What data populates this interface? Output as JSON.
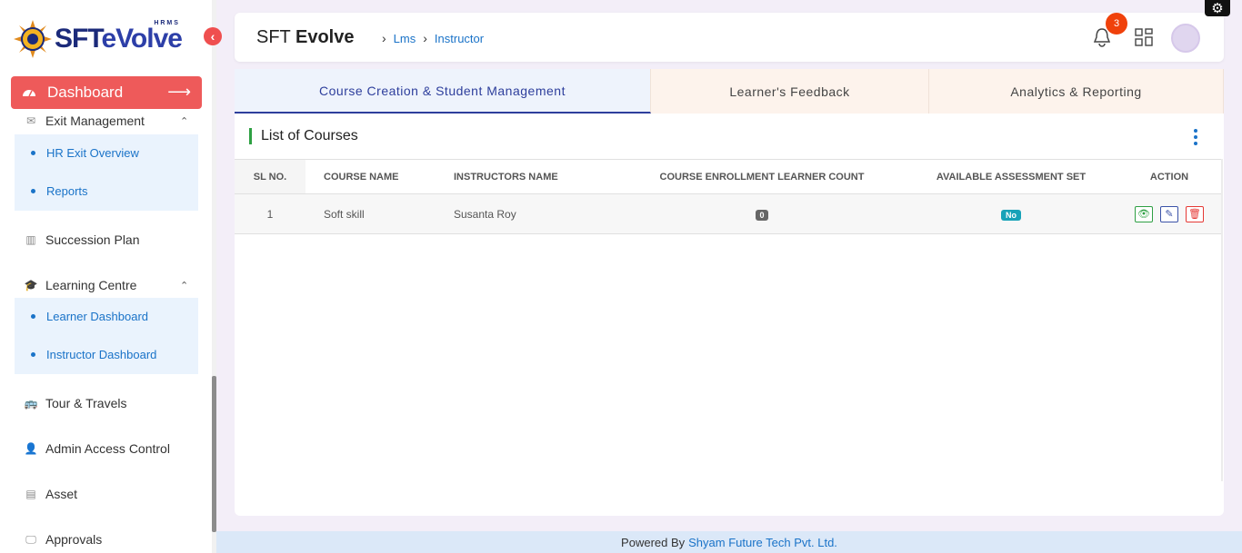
{
  "sidebar": {
    "logo": {
      "brand_main": "SFT",
      "brand_sub": "eVolve",
      "brand_tag": "HRMS"
    },
    "dashboard_label": "Dashboard",
    "exit_management": {
      "label": "Exit Management",
      "items": [
        "HR Exit Overview",
        "Reports"
      ]
    },
    "succession_plan": "Succession Plan",
    "learning_centre": {
      "label": "Learning Centre",
      "items": [
        "Learner Dashboard",
        "Instructor Dashboard"
      ]
    },
    "tour_travels": "Tour & Travels",
    "admin_access": "Admin Access Control",
    "asset": "Asset",
    "approvals": "Approvals"
  },
  "header": {
    "title_light": "SFT",
    "title_bold": "Evolve",
    "breadcrumb": [
      "Lms",
      "Instructor"
    ],
    "notification_count": "3"
  },
  "tabs": [
    "Course Creation & Student Management",
    "Learner's Feedback",
    "Analytics & Reporting"
  ],
  "content": {
    "list_title": "List of Courses",
    "columns": [
      "SL NO.",
      "COURSE NAME",
      "INSTRUCTORS NAME",
      "COURSE ENROLLMENT LEARNER COUNT",
      "AVAILABLE ASSESSMENT SET",
      "ACTION"
    ],
    "rows": [
      {
        "sl": "1",
        "course": "Soft skill",
        "instructor": "Susanta Roy",
        "count": "0",
        "assessment": "No"
      }
    ]
  },
  "footer": {
    "prefix": "Powered By",
    "company": "Shyam Future Tech Pvt. Ltd."
  },
  "colors": {
    "accent": "#2d3e9c",
    "dashboard_btn": "#ee5a5a",
    "link": "#1a73c8",
    "badge": "#f0410b"
  }
}
